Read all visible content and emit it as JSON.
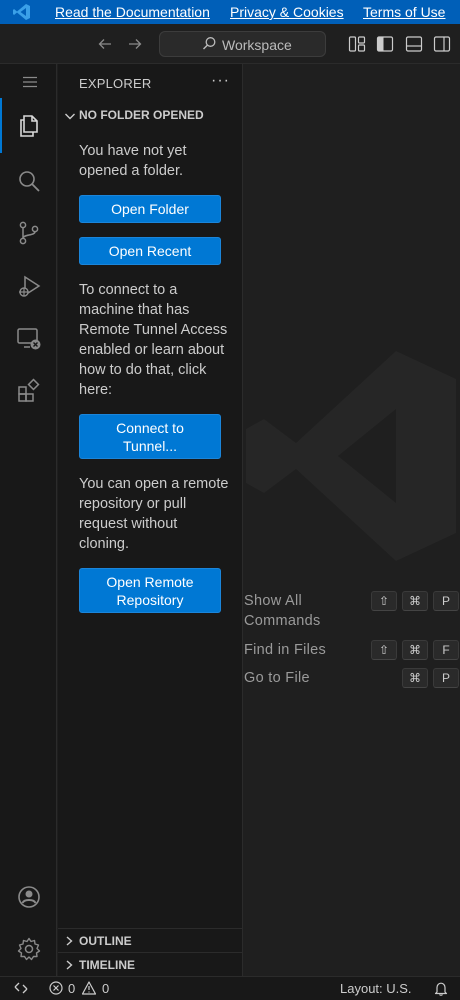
{
  "banner": {
    "links": [
      "Read the Documentation",
      "Privacy & Cookies",
      "Terms of Use"
    ],
    "bg": "#005fb8"
  },
  "titlebar": {
    "search_text": "Workspace",
    "icons": [
      "arrow-left-icon",
      "arrow-right-icon",
      "search-icon",
      "customize-layout-icon",
      "toggle-primary-sidebar-icon",
      "toggle-panel-icon",
      "toggle-secondary-sidebar-icon"
    ]
  },
  "activity_bar": {
    "items": [
      "explorer-icon",
      "search-icon",
      "source-control-icon",
      "run-debug-icon",
      "remote-explorer-icon",
      "extensions-icon"
    ],
    "bottom": [
      "accounts-icon",
      "manage-gear-icon"
    ],
    "accent": "#0078d4"
  },
  "sidebar": {
    "title": "EXPLORER",
    "more": "···",
    "section": "NO FOLDER OPENED",
    "no_folder_text": "You have not yet opened a folder.",
    "open_folder": "Open Folder",
    "open_recent": "Open Recent",
    "tunnel_text": "To connect to a machine that has Remote Tunnel Access enabled or learn about how to do that, click here:",
    "connect_tunnel": "Connect to Tunnel...",
    "remote_text": "You can open a remote repository or pull request without cloning.",
    "open_remote_repo": "Open Remote Repository",
    "outline": "OUTLINE",
    "timeline": "TIMELINE",
    "button_color": "#0078d4"
  },
  "editor": {
    "shortcuts": [
      {
        "label": "Show All Commands",
        "keys": [
          "⇧",
          "⌘",
          "P"
        ]
      },
      {
        "label": "Find in Files",
        "keys": [
          "⇧",
          "⌘",
          "F"
        ]
      },
      {
        "label": "Go to File",
        "keys": [
          "⌘",
          "P"
        ]
      }
    ]
  },
  "statusbar": {
    "errors": "0",
    "warnings": "0",
    "layout": "Layout: U.S."
  }
}
